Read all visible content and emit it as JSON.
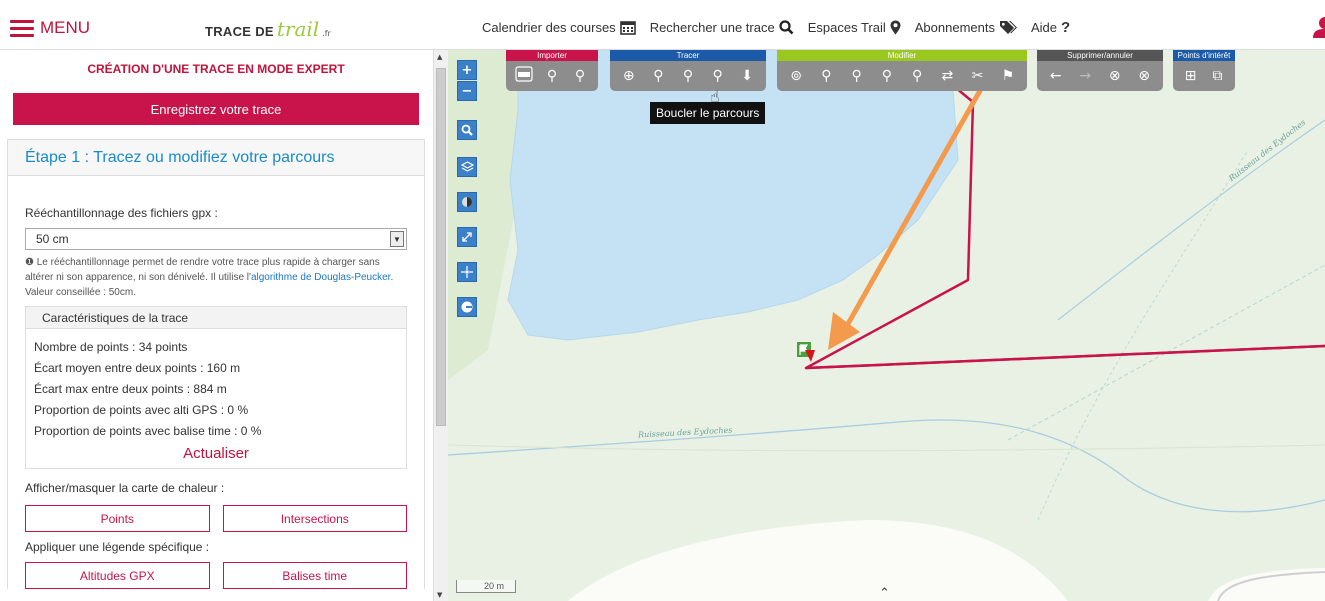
{
  "header": {
    "menu_label": "MENU",
    "logo_main": "TRACE DE",
    "logo_script": "trail",
    "logo_tld": ".fr",
    "nav": [
      {
        "label": "Calendrier des courses",
        "icon": "calendar-icon"
      },
      {
        "label": "Rechercher une trace",
        "icon": "search-icon"
      },
      {
        "label": "Espaces Trail",
        "icon": "location-pin-icon"
      },
      {
        "label": "Abonnements",
        "icon": "tags-icon"
      },
      {
        "label": "Aide",
        "icon": "help-icon"
      }
    ],
    "glyphs": {
      "calendar": "▦",
      "search": "🔍",
      "pin": "⬤",
      "tags": "◆",
      "help": "?"
    }
  },
  "sidebar": {
    "title": "CRÉATION D'UNE TRACE EN MODE EXPERT",
    "save_button": "Enregistrez votre trace",
    "step_title": "Étape 1 : Tracez ou modifiez votre parcours",
    "resample_label": "Rééchantillonnage des fichiers gpx :",
    "resample_value": "50 cm",
    "note_prefix": "❶ Le rééchantillonnage permet de rendre votre trace plus rapide à charger sans altérer ni son apparence, ni son dénivelé. Il utilise l'",
    "note_link": "algorithme de Douglas-Peucker",
    "note_suffix": ". Valeur conseillée : 50cm.",
    "charac_title": "Caractéristiques de la trace",
    "stats": [
      "Nombre de points : 34 points",
      "Écart moyen entre deux points : 160 m",
      "Écart max entre deux points : 884 m",
      "Proportion de points avec alti GPS : 0 %",
      "Proportion de points avec balise time : 0 %"
    ],
    "refresh_label": "Actualiser",
    "heatmap_label": "Afficher/masquer la carte de chaleur :",
    "heatmap_buttons": [
      "Points",
      "Intersections"
    ],
    "legend_label": "Appliquer une légende spécifique :",
    "legend_buttons": [
      "Altitudes GPX",
      "Balises time"
    ]
  },
  "map": {
    "toolbar_groups": [
      {
        "title": "Importer",
        "color": "#c8144a",
        "buttons": [
          "import-gpx",
          "import-pins",
          "import-pins-2"
        ]
      },
      {
        "title": "Tracer",
        "color": "#1a5aa8",
        "buttons": [
          "add-point",
          "draw-pins",
          "draw-route",
          "loop-route",
          "download"
        ]
      },
      {
        "title": "Modifier",
        "color": "#9ac81e",
        "buttons": [
          "edit-1",
          "edit-2",
          "edit-3",
          "edit-4",
          "edit-5",
          "edit-6",
          "edit-7",
          "edit-8"
        ]
      },
      {
        "title": "Supprimer/annuler",
        "color": "#555555",
        "buttons": [
          "undo",
          "redo",
          "delete-pins",
          "delete-pins-2"
        ]
      },
      {
        "title": "Points d'intérêt",
        "color": "#1a5aa8",
        "buttons": [
          "poi-add",
          "poi-edit"
        ]
      }
    ],
    "tooltip": "Boucler le parcours",
    "scale_label": "20 m",
    "stream_labels": [
      "Ruisseau des Eydoches",
      "Ruisseau des Eydoches"
    ],
    "colors": {
      "water": "#c4e2f4",
      "meadow": "#e3efd9",
      "route": "#c8144a",
      "arrow": "#f39a4c"
    }
  }
}
